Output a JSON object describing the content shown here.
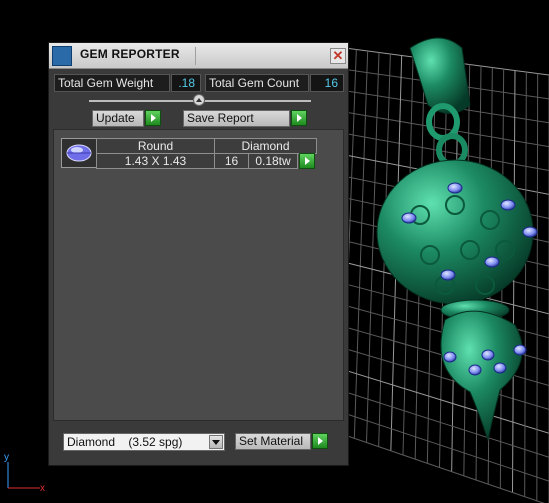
{
  "window": {
    "title": "GEM REPORTER",
    "close_glyph": "✕"
  },
  "stats": {
    "weight_label": "Total Gem Weight",
    "weight_value": ".18",
    "count_label": "Total Gem Count",
    "count_value": "16"
  },
  "toolbar": {
    "update_label": "Update",
    "save_label": "Save Report"
  },
  "gems": [
    {
      "shape": "Round",
      "type": "Diamond",
      "size": "1.43 X 1.43",
      "count": "16",
      "weight": "0.18tw"
    }
  ],
  "material": {
    "selected": "Diamond    (3.52 spg)",
    "set_label": "Set Material"
  },
  "axis": {
    "x_label": "x",
    "y_label": "y"
  },
  "colors": {
    "accent_green": "#2fae2f",
    "value_text": "#55c9e8",
    "metal": "#1c8a63",
    "gem": "#7d8cf0"
  }
}
